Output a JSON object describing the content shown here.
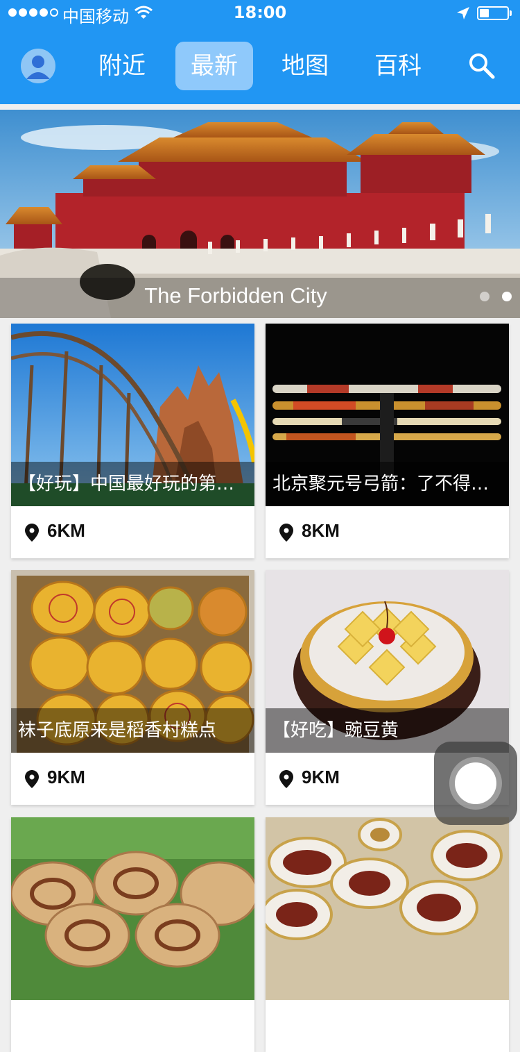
{
  "status_bar": {
    "carrier": "中国移动",
    "time": "18:00",
    "battery_level": 0.35,
    "signal_bars_filled": 4,
    "signal_bars_total": 5
  },
  "nav": {
    "tabs": [
      {
        "label": "附近"
      },
      {
        "label": "最新"
      },
      {
        "label": "地图"
      },
      {
        "label": "百科"
      }
    ],
    "active_tab": "最新",
    "avatar_icon": "user-avatar-icon",
    "search_icon": "search-icon"
  },
  "banner": {
    "title": "The Forbidden City",
    "pages": 2,
    "active_page": 2
  },
  "cards": [
    {
      "title": "【好玩】中国最好玩的第八大奇迹",
      "distance": "6KM"
    },
    {
      "title": "北京聚元号弓箭：了不得！一张弓",
      "distance": "8KM"
    },
    {
      "title": "袜子底原来是稻香村糕点",
      "distance": "9KM"
    },
    {
      "title": "【好吃】豌豆黄",
      "distance": "9KM"
    },
    {
      "title": "",
      "distance": ""
    },
    {
      "title": "",
      "distance": ""
    }
  ],
  "colors": {
    "brand": "#2196f3",
    "active_tab_bg": "#8fc9fb",
    "page_bg": "#efefef"
  }
}
